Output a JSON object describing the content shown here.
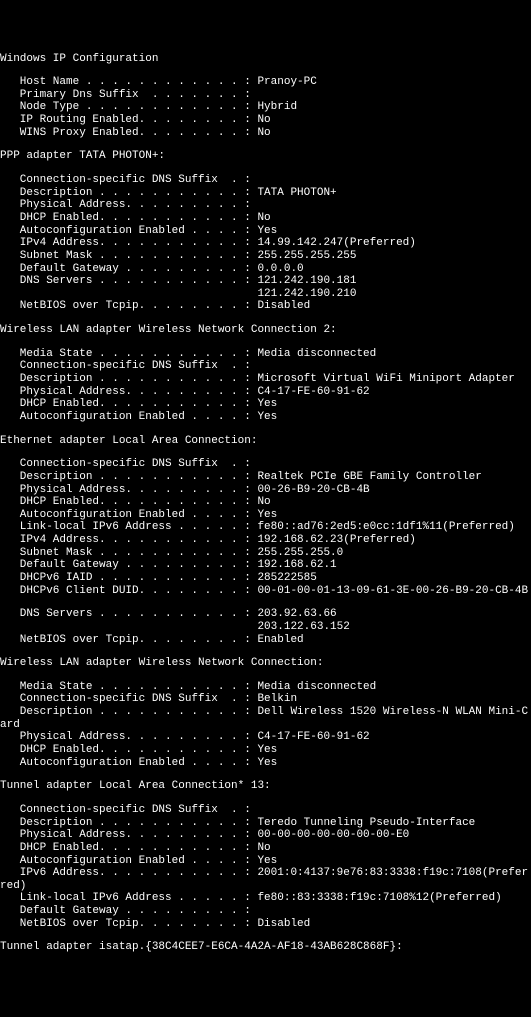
{
  "title": "Windows IP Configuration",
  "global": [
    {
      "label": "Host Name . . . . . . . . . . . . :",
      "value": " Pranoy-PC"
    },
    {
      "label": "Primary Dns Suffix  . . . . . . . :",
      "value": ""
    },
    {
      "label": "Node Type . . . . . . . . . . . . :",
      "value": " Hybrid"
    },
    {
      "label": "IP Routing Enabled. . . . . . . . :",
      "value": " No"
    },
    {
      "label": "WINS Proxy Enabled. . . . . . . . :",
      "value": " No"
    }
  ],
  "adapters": [
    {
      "name": "PPP adapter TATA PHOTON+:",
      "rows": [
        {
          "label": "Connection-specific DNS Suffix  . :",
          "value": ""
        },
        {
          "label": "Description . . . . . . . . . . . :",
          "value": " TATA PHOTON+"
        },
        {
          "label": "Physical Address. . . . . . . . . :",
          "value": ""
        },
        {
          "label": "DHCP Enabled. . . . . . . . . . . :",
          "value": " No"
        },
        {
          "label": "Autoconfiguration Enabled . . . . :",
          "value": " Yes"
        },
        {
          "label": "IPv4 Address. . . . . . . . . . . :",
          "value": " 14.99.142.247(Preferred)"
        },
        {
          "label": "Subnet Mask . . . . . . . . . . . :",
          "value": " 255.255.255.255"
        },
        {
          "label": "Default Gateway . . . . . . . . . :",
          "value": " 0.0.0.0"
        },
        {
          "label": "DNS Servers . . . . . . . . . . . :",
          "value": " 121.242.190.181"
        },
        {
          "label": "                                   ",
          "value": " 121.242.190.210"
        },
        {
          "label": "NetBIOS over Tcpip. . . . . . . . :",
          "value": " Disabled"
        }
      ]
    },
    {
      "name": "Wireless LAN adapter Wireless Network Connection 2:",
      "rows": [
        {
          "label": "Media State . . . . . . . . . . . :",
          "value": " Media disconnected"
        },
        {
          "label": "Connection-specific DNS Suffix  . :",
          "value": ""
        },
        {
          "label": "Description . . . . . . . . . . . :",
          "value": " Microsoft Virtual WiFi Miniport Adapter"
        },
        {
          "label": "Physical Address. . . . . . . . . :",
          "value": " C4-17-FE-60-91-62"
        },
        {
          "label": "DHCP Enabled. . . . . . . . . . . :",
          "value": " Yes"
        },
        {
          "label": "Autoconfiguration Enabled . . . . :",
          "value": " Yes"
        }
      ]
    },
    {
      "name": "Ethernet adapter Local Area Connection:",
      "rows": [
        {
          "label": "Connection-specific DNS Suffix  . :",
          "value": ""
        },
        {
          "label": "Description . . . . . . . . . . . :",
          "value": " Realtek PCIe GBE Family Controller"
        },
        {
          "label": "Physical Address. . . . . . . . . :",
          "value": " 00-26-B9-20-CB-4B"
        },
        {
          "label": "DHCP Enabled. . . . . . . . . . . :",
          "value": " No"
        },
        {
          "label": "Autoconfiguration Enabled . . . . :",
          "value": " Yes"
        },
        {
          "label": "Link-local IPv6 Address . . . . . :",
          "value": " fe80::ad76:2ed5:e0cc:1df1%11(Preferred)"
        },
        {
          "label": "IPv4 Address. . . . . . . . . . . :",
          "value": " 192.168.62.23(Preferred)"
        },
        {
          "label": "Subnet Mask . . . . . . . . . . . :",
          "value": " 255.255.255.0"
        },
        {
          "label": "Default Gateway . . . . . . . . . :",
          "value": " 192.168.62.1"
        },
        {
          "label": "DHCPv6 IAID . . . . . . . . . . . :",
          "value": " 285222585"
        },
        {
          "label": "DHCPv6 Client DUID. . . . . . . . :",
          "value": " 00-01-00-01-13-09-61-3E-00-26-B9-20-CB-4B"
        },
        {
          "blank": true
        },
        {
          "label": "DNS Servers . . . . . . . . . . . :",
          "value": " 203.92.63.66"
        },
        {
          "label": "                                   ",
          "value": " 203.122.63.152"
        },
        {
          "label": "NetBIOS over Tcpip. . . . . . . . :",
          "value": " Enabled"
        }
      ]
    },
    {
      "name": "Wireless LAN adapter Wireless Network Connection:",
      "rows": [
        {
          "label": "Media State . . . . . . . . . . . :",
          "value": " Media disconnected"
        },
        {
          "label": "Connection-specific DNS Suffix  . :",
          "value": " Belkin"
        },
        {
          "label": "Description . . . . . . . . . . . :",
          "value": " Dell Wireless 1520 Wireless-N WLAN Mini-Card",
          "wrap": "ard"
        },
        {
          "label": "Physical Address. . . . . . . . . :",
          "value": " C4-17-FE-60-91-62"
        },
        {
          "label": "DHCP Enabled. . . . . . . . . . . :",
          "value": " Yes"
        },
        {
          "label": "Autoconfiguration Enabled . . . . :",
          "value": " Yes"
        }
      ]
    },
    {
      "name": "Tunnel adapter Local Area Connection* 13:",
      "rows": [
        {
          "label": "Connection-specific DNS Suffix  . :",
          "value": ""
        },
        {
          "label": "Description . . . . . . . . . . . :",
          "value": " Teredo Tunneling Pseudo-Interface"
        },
        {
          "label": "Physical Address. . . . . . . . . :",
          "value": " 00-00-00-00-00-00-00-E0"
        },
        {
          "label": "DHCP Enabled. . . . . . . . . . . :",
          "value": " No"
        },
        {
          "label": "Autoconfiguration Enabled . . . . :",
          "value": " Yes"
        },
        {
          "label": "IPv6 Address. . . . . . . . . . . :",
          "value": " 2001:0:4137:9e76:83:3338:f19c:7108(Preferred)",
          "wrap": "red)"
        },
        {
          "label": "Link-local IPv6 Address . . . . . :",
          "value": " fe80::83:3338:f19c:7108%12(Preferred)"
        },
        {
          "label": "Default Gateway . . . . . . . . . :",
          "value": ""
        },
        {
          "label": "NetBIOS over Tcpip. . . . . . . . :",
          "value": " Disabled"
        }
      ]
    },
    {
      "name": "Tunnel adapter isatap.{38C4CEE7-E6CA-4A2A-AF18-43AB628C868F}:",
      "rows": []
    }
  ]
}
